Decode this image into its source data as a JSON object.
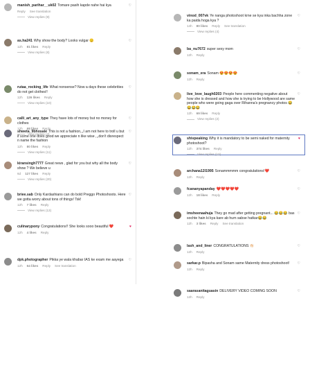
{
  "left": [
    {
      "user": "manish_parihar__uk02",
      "text": "Tomare pasih kapde nahe hai kya",
      "time": "",
      "likes": "",
      "reply": "Reply",
      "translate": "See translation",
      "replies": "View replies (9)",
      "heart_red": false
    },
    {
      "user": "as.ha241",
      "text": "Why show the body? Looks vulgar 😐",
      "time": "12h",
      "likes": "81 likes",
      "reply": "Reply",
      "translate": "",
      "replies": "View replies (8)",
      "heart_red": false
    },
    {
      "user": "rutaa_rocking_life",
      "text": "What nonsense? Now a days these celebrities do not get clothes!!",
      "time": "12h",
      "likes": "126 likes",
      "reply": "Reply",
      "translate": "",
      "replies": "View replies (10)",
      "heart_red": false
    },
    {
      "user": "calli_art_any_type",
      "text": "They have lots of money but no money for clothes",
      "time": "12h",
      "likes": "68 likes",
      "reply": "Reply",
      "translate": "",
      "replies": "View replies (4)",
      "heart_red": false
    },
    {
      "user": "shweta_9bhosale",
      "text": "This is not a fashion,,,I am not here to troll u but if some one does good we appreciate n like wise ,,,don't disrespect n name the fashion",
      "time": "12h",
      "likes": "80 likes",
      "reply": "Reply",
      "translate": "",
      "replies": "View replies (11)",
      "heart_red": false
    },
    {
      "user": "kiransingh7777",
      "text": "Great news , glad for you but why all the body show ? We believe u",
      "time": "6d",
      "likes": "127 likes",
      "reply": "Reply",
      "translate": "",
      "replies": "View replies (20)",
      "heart_red": false
    },
    {
      "user": "briee.sab",
      "text": "Only Kardashians can do bold Preggo Photoshoots. Here we gotta worry about tons of things! Tsk!",
      "time": "12h",
      "likes": "7 likes",
      "reply": "Reply",
      "translate": "",
      "replies": "View replies (13)",
      "heart_red": false
    },
    {
      "user": "culinarypony",
      "text": "Congratulations!! She looks sooo beautiful ❤️",
      "time": "12h",
      "likes": "4 likes",
      "reply": "Reply",
      "translate": "",
      "replies": "",
      "heart_red": true
    },
    {
      "user": "dpk.photographer",
      "text": "Pikka ye wala khabar IAS ke exam me aayega",
      "time": "12h",
      "likes": "64 likes",
      "reply": "Reply",
      "translate": "See translation",
      "replies": "",
      "heart_red": false
    }
  ],
  "right": [
    {
      "user": "vinod_007vk",
      "text": "Ye nanga photoshoot krne se kya inka bachha zone ka paida hoga kya ?",
      "time": "14h",
      "likes": "80 likes",
      "reply": "Reply",
      "translate": "See translation",
      "replies": "View replies (4)",
      "heart_red": false
    },
    {
      "user": "ba_nu7672",
      "text": "super sexy mom",
      "time": "12h",
      "likes": "",
      "reply": "Reply",
      "translate": "",
      "replies": "",
      "heart_red": false
    },
    {
      "user": "sonam_era",
      "text": "Sonam 😍😍😍😍",
      "time": "12h",
      "likes": "",
      "reply": "Reply",
      "translate": "",
      "replies": "",
      "heart_red": false
    },
    {
      "user": "live_love_laugh0203",
      "text": "People here commenting negative about how she is dressed and how she is trying to be Hollywood are same people who were going gaga over Rihanna's pregnancy photos 😂😂😂😂",
      "time": "12h",
      "likes": "69 likes",
      "reply": "Reply",
      "translate": "",
      "replies": "View replies (2)",
      "heart_red": false
    },
    {
      "user": "shivpeaking",
      "text": "Why it is mandatory to be semi naked for maternity photoshoot?",
      "time": "12h",
      "likes": "374 likes",
      "reply": "Reply",
      "translate": "",
      "replies": "View replies (13)",
      "heart_red": true
    },
    {
      "user": "archana12l1995",
      "text": "Sonammmmm congratulations!❤️",
      "time": "12h",
      "likes": "",
      "reply": "Reply",
      "translate": "",
      "replies": "",
      "heart_red": false
    },
    {
      "user": "fcananyapanday",
      "text": "❤️❤️❤️❤️❤️",
      "time": "12h",
      "likes": "18 likes",
      "reply": "Reply",
      "translate": "",
      "replies": "",
      "heart_red": false
    },
    {
      "user": "imsheenaahuja",
      "text": "They go mad after getting pregnant... 😂😂😂 bas sochte hain ki kya kare ab hum sabse hatkar😂😂",
      "time": "12h",
      "likes": "3 likes",
      "reply": "Reply",
      "translate": "See translation",
      "replies": "",
      "heart_red": false
    },
    {
      "user": "lash_and_liner",
      "text": "CONGRATULATIONS 👏🏻",
      "time": "12h",
      "likes": "",
      "reply": "Reply",
      "translate": "",
      "replies": "",
      "heart_red": false
    },
    {
      "user": "sarkar.p",
      "text": "Bipasha and Sonam same Maternity dress photoshoot!",
      "time": "12h",
      "likes": "",
      "reply": "Reply",
      "translate": "",
      "replies": "",
      "heart_red": false
    },
    {
      "user": "saarasanitaguasin",
      "text": "DELIVERY VIDEO COMING SOON",
      "time": "12h",
      "likes": "",
      "reply": "Reply",
      "translate": "",
      "replies": "",
      "heart_red": false
    }
  ],
  "icons": {
    "heart": "heart-icon",
    "avatar": "avatar"
  },
  "colors": {
    "accent_heart": "#e0245e",
    "highlight_border": "#5e78c2"
  }
}
